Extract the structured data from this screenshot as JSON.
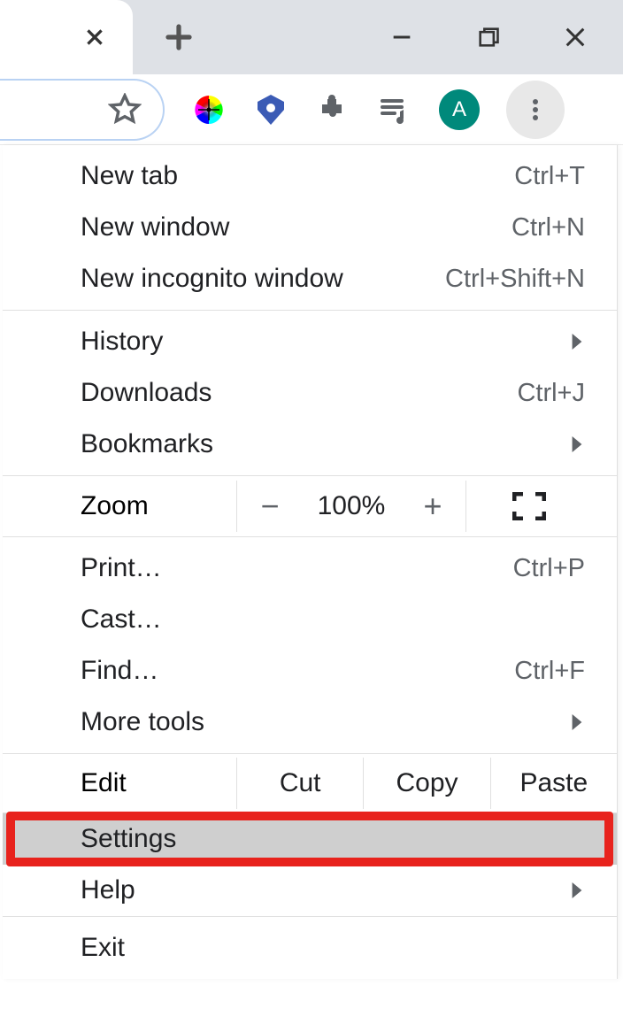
{
  "avatar_letter": "A",
  "menu": {
    "new_tab": {
      "label": "New tab",
      "shortcut": "Ctrl+T"
    },
    "new_window": {
      "label": "New window",
      "shortcut": "Ctrl+N"
    },
    "new_incognito": {
      "label": "New incognito window",
      "shortcut": "Ctrl+Shift+N"
    },
    "history": {
      "label": "History"
    },
    "downloads": {
      "label": "Downloads",
      "shortcut": "Ctrl+J"
    },
    "bookmarks": {
      "label": "Bookmarks"
    },
    "zoom": {
      "label": "Zoom",
      "value": "100%",
      "minus": "−",
      "plus": "+"
    },
    "print": {
      "label": "Print…",
      "shortcut": "Ctrl+P"
    },
    "cast": {
      "label": "Cast…"
    },
    "find": {
      "label": "Find…",
      "shortcut": "Ctrl+F"
    },
    "more_tools": {
      "label": "More tools"
    },
    "edit": {
      "label": "Edit",
      "cut": "Cut",
      "copy": "Copy",
      "paste": "Paste"
    },
    "settings": {
      "label": "Settings"
    },
    "help": {
      "label": "Help"
    },
    "exit": {
      "label": "Exit"
    }
  }
}
